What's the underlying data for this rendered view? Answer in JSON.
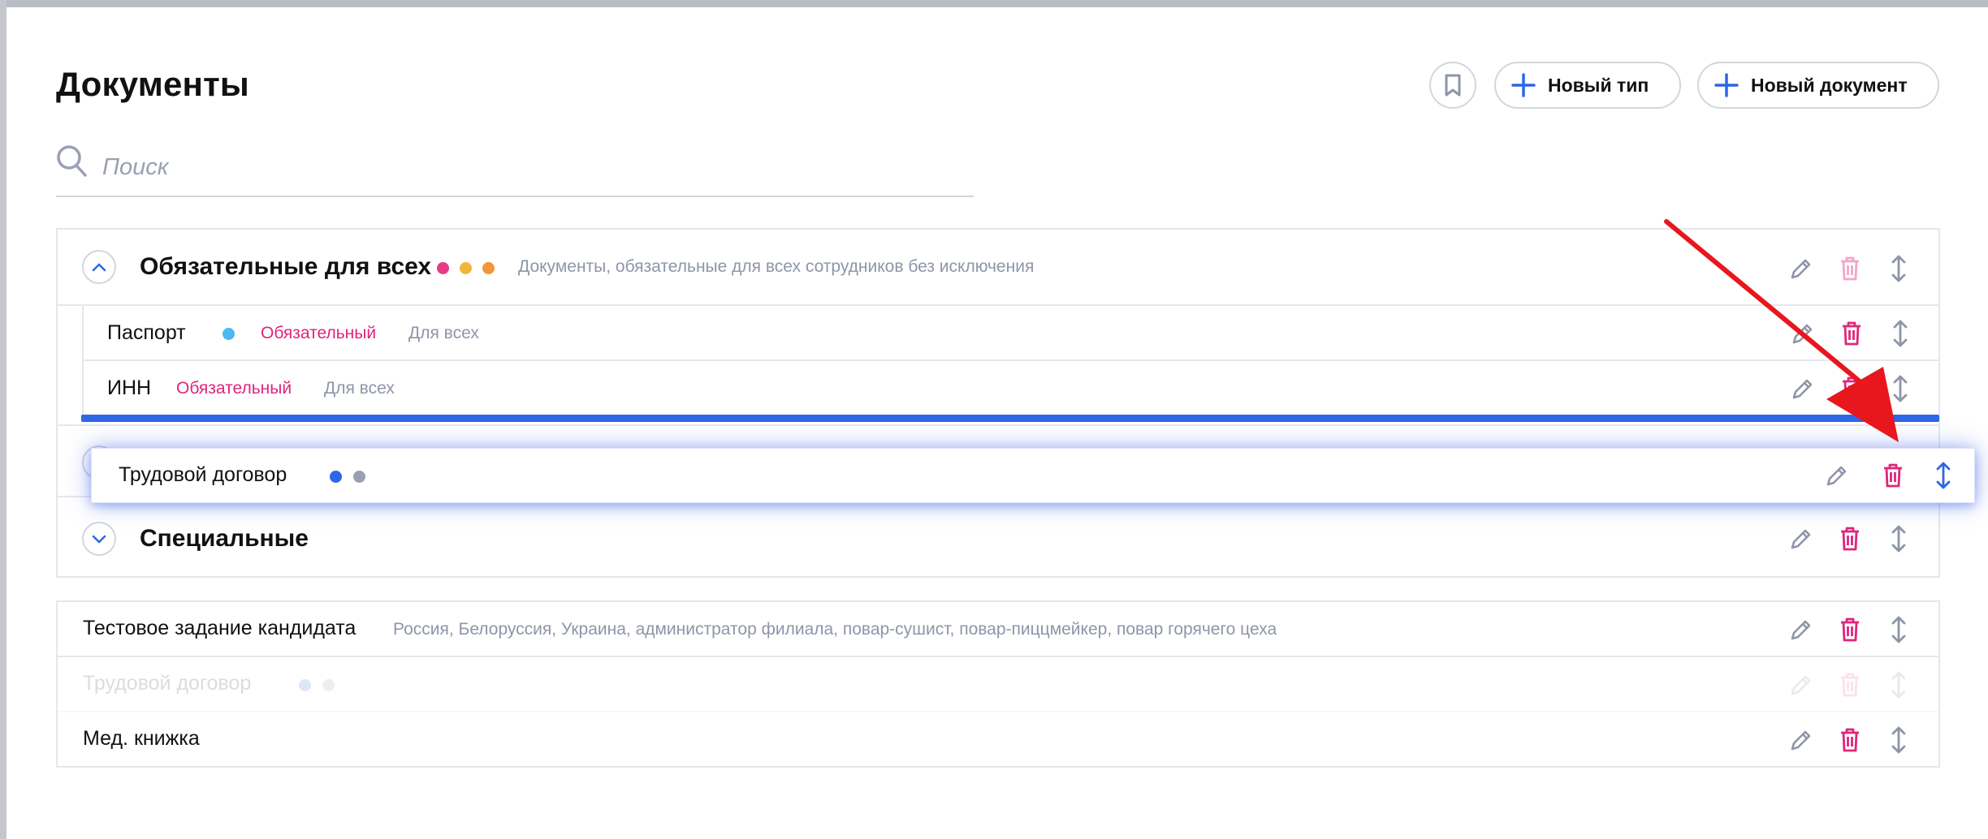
{
  "header": {
    "title": "Документы",
    "bookmark_icon": "bookmark-icon",
    "new_type_label": "Новый тип",
    "new_document_label": "Новый документ",
    "plus_icon": "plus-icon"
  },
  "search": {
    "placeholder": "Поиск",
    "value": "",
    "icon": "search-icon"
  },
  "groups": [
    {
      "title": "Обязательные для всех",
      "description": "Документы, обязательные для всех сотрудников без исключения",
      "expanded": true,
      "dots": [
        "#e63b86",
        "#f2b63a",
        "#f2963a"
      ],
      "documents": [
        {
          "title": "Паспорт",
          "dot": "#4cb9f0",
          "required_label": "Обязательный",
          "scope_label": "Для всех"
        },
        {
          "title": "ИНН",
          "required_label": "Обязательный",
          "scope_label": "Для всех"
        }
      ]
    },
    {
      "title": "Специальные",
      "expanded": false
    }
  ],
  "dragging": {
    "title": "Трудовой договор",
    "dots": [
      "#2e66e8",
      "#9aa0b3"
    ]
  },
  "ungrouped": [
    {
      "title": "Тестовое задание кандидата",
      "description": "Россия, Белоруссия, Украина, администратор филиала, повар-сушист, повар-пиццмейкер, повар горячего цеха"
    },
    {
      "title": "Трудовой договор",
      "placeholder": true
    },
    {
      "title": "Мед. книжка"
    }
  ],
  "actions": {
    "edit_icon": "pencil-icon",
    "delete_icon": "trash-icon",
    "move_icon": "drag-vertical-icon"
  },
  "colors": {
    "accent": "#2e66e8",
    "danger": "#e0257c",
    "muted": "#8e95a8",
    "annotation_arrow": "#e8161d"
  }
}
